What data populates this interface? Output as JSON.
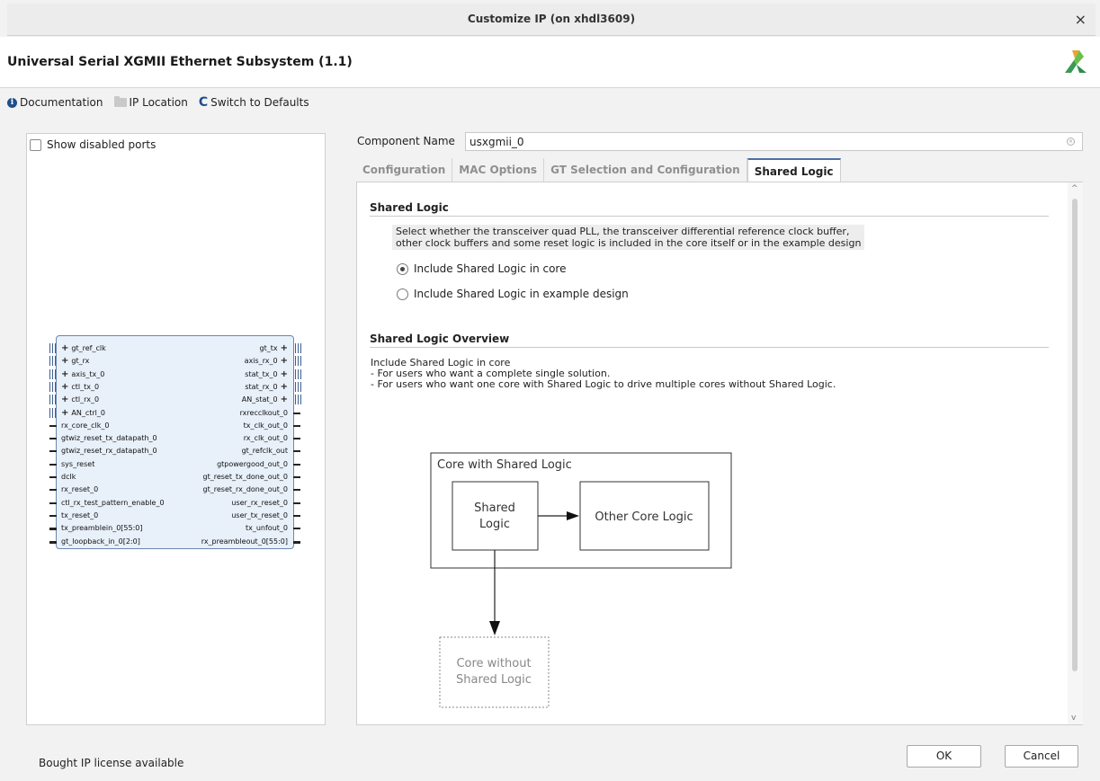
{
  "window": {
    "title": "Customize IP (on xhdl3609)",
    "close_glyph": "×"
  },
  "header": {
    "ip_title": "Universal Serial XGMII Ethernet Subsystem (1.1)"
  },
  "toolbar": {
    "documentation": "Documentation",
    "ip_location": "IP Location",
    "switch_defaults": "Switch to Defaults"
  },
  "left_panel": {
    "show_disabled_ports": "Show disabled ports",
    "show_disabled_ports_checked": false,
    "left_ports": [
      {
        "name": "gt_ref_clk",
        "kind": "interface"
      },
      {
        "name": "gt_rx",
        "kind": "interface"
      },
      {
        "name": "axis_tx_0",
        "kind": "interface"
      },
      {
        "name": "ctl_tx_0",
        "kind": "interface"
      },
      {
        "name": "ctl_rx_0",
        "kind": "interface"
      },
      {
        "name": "AN_ctrl_0",
        "kind": "interface"
      },
      {
        "name": "rx_core_clk_0",
        "kind": "wire"
      },
      {
        "name": "gtwiz_reset_tx_datapath_0",
        "kind": "wire"
      },
      {
        "name": "gtwiz_reset_rx_datapath_0",
        "kind": "wire"
      },
      {
        "name": "sys_reset",
        "kind": "wire"
      },
      {
        "name": "dclk",
        "kind": "wire"
      },
      {
        "name": "rx_reset_0",
        "kind": "wire"
      },
      {
        "name": "ctl_rx_test_pattern_enable_0",
        "kind": "wire"
      },
      {
        "name": "tx_reset_0",
        "kind": "wire"
      },
      {
        "name": "tx_preamblein_0[55:0]",
        "kind": "bus"
      },
      {
        "name": "gt_loopback_in_0[2:0]",
        "kind": "bus"
      }
    ],
    "right_ports": [
      {
        "name": "gt_tx",
        "kind": "interface"
      },
      {
        "name": "axis_rx_0",
        "kind": "interface"
      },
      {
        "name": "stat_tx_0",
        "kind": "interface"
      },
      {
        "name": "stat_rx_0",
        "kind": "interface"
      },
      {
        "name": "AN_stat_0",
        "kind": "interface"
      },
      {
        "name": "rxrecclkout_0",
        "kind": "wire"
      },
      {
        "name": "tx_clk_out_0",
        "kind": "wire"
      },
      {
        "name": "rx_clk_out_0",
        "kind": "wire"
      },
      {
        "name": "gt_refclk_out",
        "kind": "wire"
      },
      {
        "name": "gtpowergood_out_0",
        "kind": "wire"
      },
      {
        "name": "gt_reset_tx_done_out_0",
        "kind": "wire"
      },
      {
        "name": "gt_reset_rx_done_out_0",
        "kind": "wire"
      },
      {
        "name": "user_rx_reset_0",
        "kind": "wire"
      },
      {
        "name": "user_tx_reset_0",
        "kind": "wire"
      },
      {
        "name": "tx_unfout_0",
        "kind": "wire"
      },
      {
        "name": "rx_preambleout_0[55:0]",
        "kind": "bus"
      }
    ]
  },
  "status": {
    "text": "Bought IP license available"
  },
  "component": {
    "label": "Component Name",
    "value": "usxgmii_0"
  },
  "tabs": [
    {
      "label": "Configuration",
      "active": false
    },
    {
      "label": "MAC Options",
      "active": false
    },
    {
      "label": "GT Selection and Configuration",
      "active": false
    },
    {
      "label": "Shared Logic",
      "active": true
    }
  ],
  "shared_logic": {
    "title": "Shared Logic",
    "desc_line1": "Select whether the transceiver quad PLL, the transceiver differential reference clock buffer,",
    "desc_line2": "other clock buffers and some reset logic is included in the core itself or in the example design",
    "options": [
      {
        "label": "Include Shared Logic in core",
        "selected": true
      },
      {
        "label": "Include Shared Logic in example design",
        "selected": false
      }
    ]
  },
  "overview": {
    "title": "Shared Logic Overview",
    "lines": [
      "Include Shared Logic in core",
      "- For users who want a complete single solution.",
      "- For users who want one core with Shared Logic to drive multiple cores without Shared Logic."
    ],
    "diagram": {
      "outer_label": "Core with Shared Logic",
      "shared_line1": "Shared",
      "shared_line2": "Logic",
      "other_label": "Other Core Logic",
      "without_line1": "Core without",
      "without_line2": "Shared Logic"
    }
  },
  "buttons": {
    "ok": "OK",
    "cancel": "Cancel"
  }
}
